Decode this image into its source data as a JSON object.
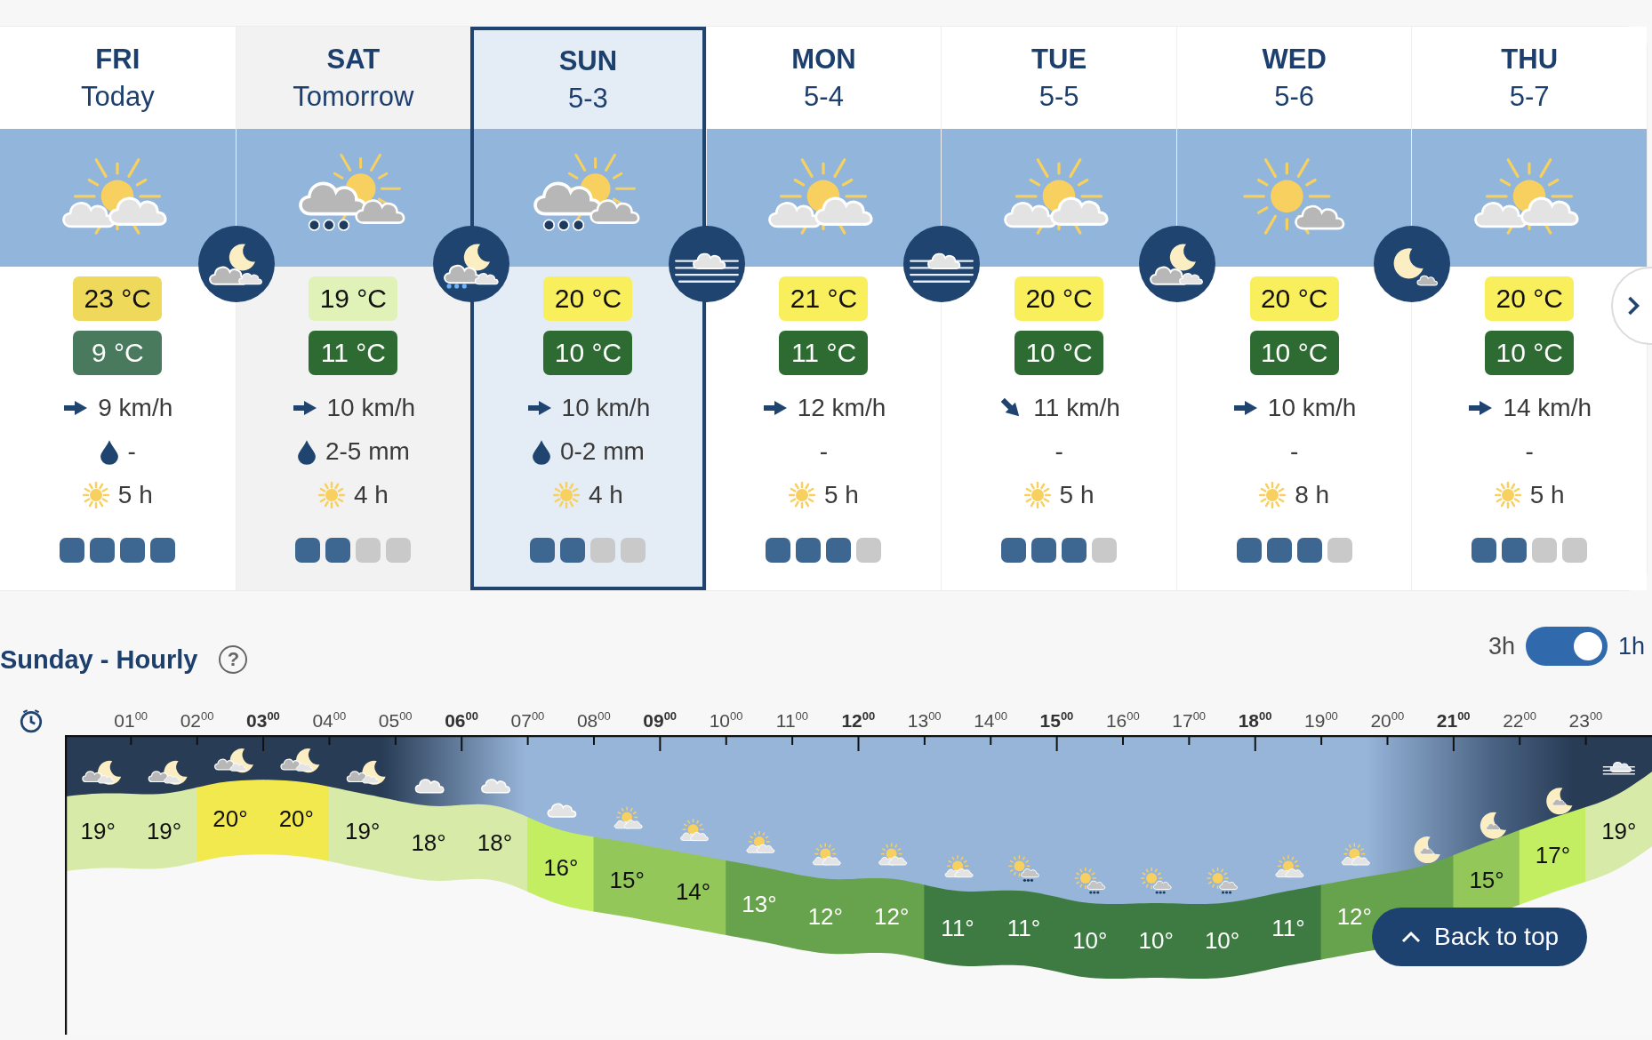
{
  "days": [
    {
      "day": "FRI",
      "date": "Today",
      "selected": false,
      "hovered": false,
      "day_icon": {
        "kind": "sun-clouds"
      },
      "night_icon": {
        "kind": "night-cloud"
      },
      "max": {
        "text": "23 °C",
        "color": "#efd95a"
      },
      "min": {
        "text": "9 °C",
        "color": "#4a7a5e"
      },
      "wind": {
        "kind": "e",
        "text": "9 km/h"
      },
      "rain": {
        "icon": true,
        "text": "-"
      },
      "sun": "5 h",
      "stars": 4
    },
    {
      "day": "SAT",
      "date": "Tomorrow",
      "selected": false,
      "hovered": true,
      "day_icon": {
        "kind": "sun-rain"
      },
      "night_icon": {
        "kind": "night-rain"
      },
      "max": {
        "text": "19 °C",
        "color": "#e1f2b9"
      },
      "min": {
        "text": "11 °C",
        "color": "#2e6b33"
      },
      "wind": {
        "kind": "e",
        "text": "10 km/h"
      },
      "rain": {
        "icon": true,
        "text": "2-5 mm"
      },
      "sun": "4 h",
      "stars": 2
    },
    {
      "day": "SUN",
      "date": "5-3",
      "selected": true,
      "hovered": false,
      "day_icon": {
        "kind": "sun-rain"
      },
      "night_icon": {
        "kind": "fog"
      },
      "max": {
        "text": "20 °C",
        "color": "#f9ef5d"
      },
      "min": {
        "text": "10 °C",
        "color": "#2e6b33"
      },
      "wind": {
        "kind": "e",
        "text": "10 km/h"
      },
      "rain": {
        "icon": true,
        "text": "0-2 mm"
      },
      "sun": "4 h",
      "stars": 2
    },
    {
      "day": "MON",
      "date": "5-4",
      "selected": false,
      "hovered": false,
      "day_icon": {
        "kind": "sun-clouds"
      },
      "night_icon": {
        "kind": "fog"
      },
      "max": {
        "text": "21 °C",
        "color": "#f9ef5d"
      },
      "min": {
        "text": "11 °C",
        "color": "#2e6b33"
      },
      "wind": {
        "kind": "e",
        "text": "12 km/h"
      },
      "rain": {
        "icon": false,
        "text": "-"
      },
      "sun": "5 h",
      "stars": 3
    },
    {
      "day": "TUE",
      "date": "5-5",
      "selected": false,
      "hovered": false,
      "day_icon": {
        "kind": "sun-clouds"
      },
      "night_icon": {
        "kind": "night-cloud"
      },
      "max": {
        "text": "20 °C",
        "color": "#f9ef5d"
      },
      "min": {
        "text": "10 °C",
        "color": "#2e6b33"
      },
      "wind": {
        "kind": "se",
        "text": "11 km/h"
      },
      "rain": {
        "icon": false,
        "text": "-"
      },
      "sun": "5 h",
      "stars": 3
    },
    {
      "day": "WED",
      "date": "5-6",
      "selected": false,
      "hovered": false,
      "day_icon": {
        "kind": "sun-cloud"
      },
      "night_icon": {
        "kind": "night-clear"
      },
      "max": {
        "text": "20 °C",
        "color": "#f9ef5d"
      },
      "min": {
        "text": "10 °C",
        "color": "#2e6b33"
      },
      "wind": {
        "kind": "e",
        "text": "10 km/h"
      },
      "rain": {
        "icon": false,
        "text": "-"
      },
      "sun": "8 h",
      "stars": 3
    },
    {
      "day": "THU",
      "date": "5-7",
      "selected": false,
      "hovered": false,
      "day_icon": {
        "kind": "sun-clouds"
      },
      "max": {
        "text": "20 °C",
        "color": "#f9ef5d"
      },
      "min": {
        "text": "10 °C",
        "color": "#2e6b33"
      },
      "wind": {
        "kind": "e",
        "text": "14 km/h"
      },
      "rain": {
        "icon": false,
        "text": "-"
      },
      "sun": "5 h",
      "stars": 2
    }
  ],
  "hourly": {
    "title": "Sunday - Hourly",
    "help": "?",
    "toggle": {
      "left": "3h",
      "right": "1h",
      "on": true
    },
    "time_labels": [
      "01$^{00}$",
      "02$^{00}$",
      "**03**$^{00}$",
      "04$^{00}$",
      "05$^{00}$",
      "**06**$^{00}$",
      "07$^{00}$",
      "08$^{00}$",
      "**09**$^{00}$",
      "10$^{00}$",
      "11$^{00}$",
      "**12**$^{00}$",
      "13$^{00}$",
      "14$^{00}$",
      "**15**$^{00}$",
      "16$^{00}$",
      "17$^{00}$",
      "**18**$^{00}$",
      "19$^{00}$",
      "20$^{00}$",
      "**21**$^{00}$",
      "22$^{00}$",
      "23$^{00}$"
    ],
    "hours": [
      {
        "kind": "night-cloud",
        "temp": "19°",
        "color": "#d7eaa8"
      },
      {
        "kind": "night-cloud",
        "temp": "19°",
        "color": "#d7eaa8"
      },
      {
        "kind": "night-cloud",
        "temp": "20°",
        "color": "#f2e94e"
      },
      {
        "kind": "night-cloud",
        "temp": "20°",
        "color": "#f2e94e"
      },
      {
        "kind": "night-cloud",
        "temp": "19°",
        "color": "#d7eaa8"
      },
      {
        "kind": "cloud",
        "temp": "18°",
        "color": "#d7eaa8"
      },
      {
        "kind": "cloud",
        "temp": "18°",
        "color": "#d7eaa8"
      },
      {
        "kind": "cloud",
        "temp": "16°",
        "color": "#c4ee62"
      },
      {
        "kind": "sun-cloud",
        "temp": "15°",
        "color": "#93c759"
      },
      {
        "kind": "sun-cloud",
        "temp": "14°",
        "color": "#93c759"
      },
      {
        "kind": "sun-cloud",
        "temp": "13°",
        "color": "#67a24c"
      },
      {
        "kind": "sun-cloud",
        "temp": "12°",
        "color": "#67a24c"
      },
      {
        "kind": "sun-cloud",
        "temp": "12°",
        "color": "#67a24c"
      },
      {
        "kind": "sun-cloud",
        "temp": "11°",
        "color": "#3e7b42"
      },
      {
        "kind": "sun-rain",
        "temp": "11°",
        "color": "#3e7b42"
      },
      {
        "kind": "sun-rain",
        "temp": "10°",
        "color": "#3e7b42"
      },
      {
        "kind": "sun-rain",
        "temp": "10°",
        "color": "#3e7b42"
      },
      {
        "kind": "sun-rain",
        "temp": "10°",
        "color": "#3e7b42"
      },
      {
        "kind": "sun-cloud",
        "temp": "11°",
        "color": "#3e7b42"
      },
      {
        "kind": "sun-cloud",
        "temp": "12°",
        "color": "#67a24c"
      },
      {
        "kind": "moon",
        "color": "#67a24c"
      },
      {
        "kind": "moon",
        "temp": "15°",
        "color": "#93c759"
      },
      {
        "kind": "moon",
        "temp": "17°",
        "color": "#c4ee62"
      },
      {
        "kind": "fog",
        "temp": "19°",
        "color": "#d7eaa8"
      }
    ]
  },
  "back_to_top": "Back to top"
}
